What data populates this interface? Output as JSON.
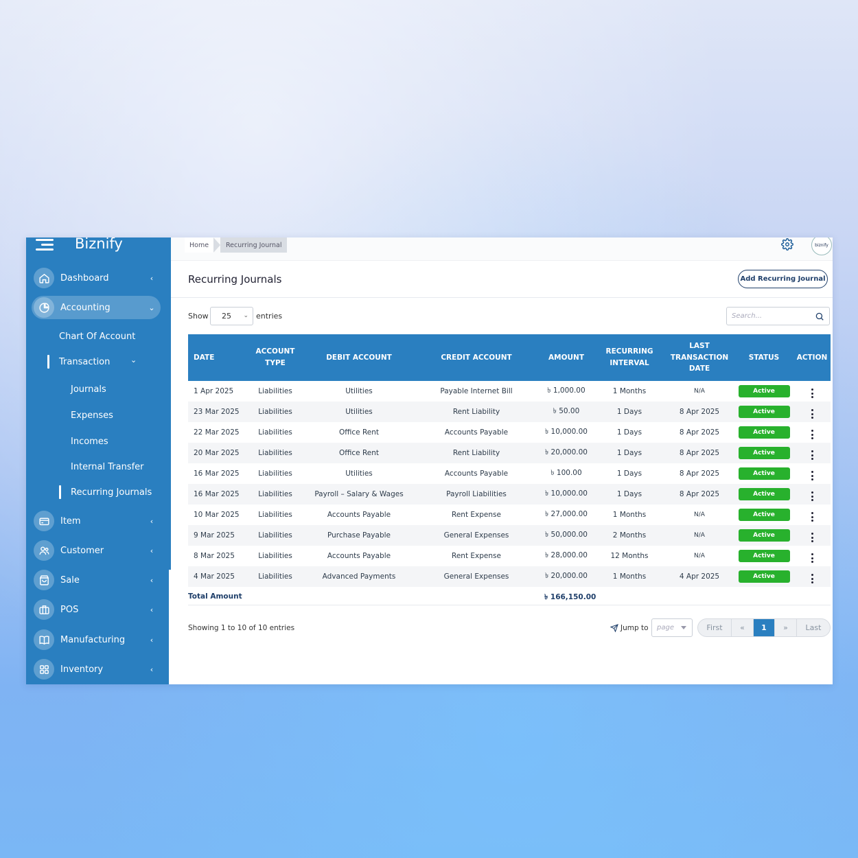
{
  "brand": "Biznify",
  "sidebar": {
    "items": [
      {
        "label": "Dashboard"
      },
      {
        "label": "Accounting"
      },
      {
        "label": "Item"
      },
      {
        "label": "Customer"
      },
      {
        "label": "Sale"
      },
      {
        "label": "POS"
      },
      {
        "label": "Manufacturing"
      },
      {
        "label": "Inventory"
      }
    ],
    "accounting_sub": {
      "chart_of_account": "Chart Of Account",
      "transaction": "Transaction",
      "journals": "Journals",
      "expenses": "Expenses",
      "incomes": "Incomes",
      "internal_transfer": "Internal Transfer",
      "recurring_journals": "Recurring Journals"
    }
  },
  "breadcrumb": {
    "home": "Home",
    "current": "Recurring Journal"
  },
  "avatar_text": "biznify",
  "page": {
    "title": "Recurring Journals",
    "add_button": "Add Recurring Journal",
    "show_label": "Show",
    "entries_value": "25",
    "entries_label": "entries",
    "search_placeholder": "Search..."
  },
  "table": {
    "headers": {
      "date": "DATE",
      "account_type": "ACCOUNT TYPE",
      "debit_account": "DEBIT ACCOUNT",
      "credit_account": "CREDIT ACCOUNT",
      "amount": "AMOUNT",
      "recurring_interval": "RECURRING INTERVAL",
      "last_transaction_date": "LAST TRANSACTION DATE",
      "status": "STATUS",
      "action": "ACTION"
    },
    "rows": [
      {
        "date": "1 Apr 2025",
        "type": "Liabilities",
        "debit": "Utilities",
        "credit": "Payable Internet Bill",
        "amount": "৳ 1,000.00",
        "interval": "1 Months",
        "last": "N/A",
        "status": "Active"
      },
      {
        "date": "23 Mar 2025",
        "type": "Liabilities",
        "debit": "Utilities",
        "credit": "Rent Liability",
        "amount": "৳ 50.00",
        "interval": "1 Days",
        "last": "8 Apr 2025",
        "status": "Active"
      },
      {
        "date": "22 Mar 2025",
        "type": "Liabilities",
        "debit": "Office Rent",
        "credit": "Accounts Payable",
        "amount": "৳ 10,000.00",
        "interval": "1 Days",
        "last": "8 Apr 2025",
        "status": "Active"
      },
      {
        "date": "20 Mar 2025",
        "type": "Liabilities",
        "debit": "Office Rent",
        "credit": "Rent Liability",
        "amount": "৳ 20,000.00",
        "interval": "1 Days",
        "last": "8 Apr 2025",
        "status": "Active"
      },
      {
        "date": "16 Mar 2025",
        "type": "Liabilities",
        "debit": "Utilities",
        "credit": "Accounts Payable",
        "amount": "৳ 100.00",
        "interval": "1 Days",
        "last": "8 Apr 2025",
        "status": "Active"
      },
      {
        "date": "16 Mar 2025",
        "type": "Liabilities",
        "debit": "Payroll – Salary & Wages",
        "credit": "Payroll Liabilities",
        "amount": "৳ 10,000.00",
        "interval": "1 Days",
        "last": "8 Apr 2025",
        "status": "Active"
      },
      {
        "date": "10 Mar 2025",
        "type": "Liabilities",
        "debit": "Accounts Payable",
        "credit": "Rent Expense",
        "amount": "৳ 27,000.00",
        "interval": "1 Months",
        "last": "N/A",
        "status": "Active"
      },
      {
        "date": "9 Mar 2025",
        "type": "Liabilities",
        "debit": "Purchase Payable",
        "credit": "General Expenses",
        "amount": "৳ 50,000.00",
        "interval": "2 Months",
        "last": "N/A",
        "status": "Active"
      },
      {
        "date": "8 Mar 2025",
        "type": "Liabilities",
        "debit": "Accounts Payable",
        "credit": "Rent Expense",
        "amount": "৳ 28,000.00",
        "interval": "12 Months",
        "last": "N/A",
        "status": "Active"
      },
      {
        "date": "4 Mar 2025",
        "type": "Liabilities",
        "debit": "Advanced Payments",
        "credit": "General Expenses",
        "amount": "৳ 20,000.00",
        "interval": "1 Months",
        "last": "4 Apr 2025",
        "status": "Active"
      }
    ],
    "total_label": "Total Amount",
    "total_value": "৳ 166,150.00"
  },
  "footer": {
    "showing": "Showing 1 to 10 of 10 entries",
    "jump_label": "Jump to",
    "page_placeholder": "page",
    "first": "First",
    "prev": "«",
    "current_page": "1",
    "next": "»",
    "last": "Last"
  },
  "colors": {
    "sidebar": "#2a7fc0",
    "status_active": "#28b12d",
    "header": "#2a7fc0"
  }
}
